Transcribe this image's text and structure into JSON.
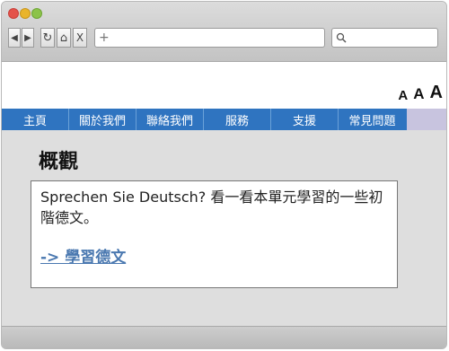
{
  "toolbar": {
    "back_icon": "◀",
    "forward_icon": "▶",
    "reload_icon": "↻",
    "home_icon": "⌂",
    "close_icon": "X",
    "new_tab_icon": "+",
    "search_icon": "magnifier"
  },
  "font_sizes": [
    "A",
    "A",
    "A"
  ],
  "nav": [
    "主頁",
    "關於我們",
    "聯絡我們",
    "服務",
    "支援",
    "常見問題"
  ],
  "colors": {
    "nav_bg": "#2f74c0",
    "nav_tail": "#c8c4df",
    "link": "#4a78b0"
  },
  "content": {
    "title": "概觀",
    "body": "Sprechen Sie Deutsch? 看一看本單元學習的一些初階德文。",
    "link": "-> 學習德文"
  }
}
